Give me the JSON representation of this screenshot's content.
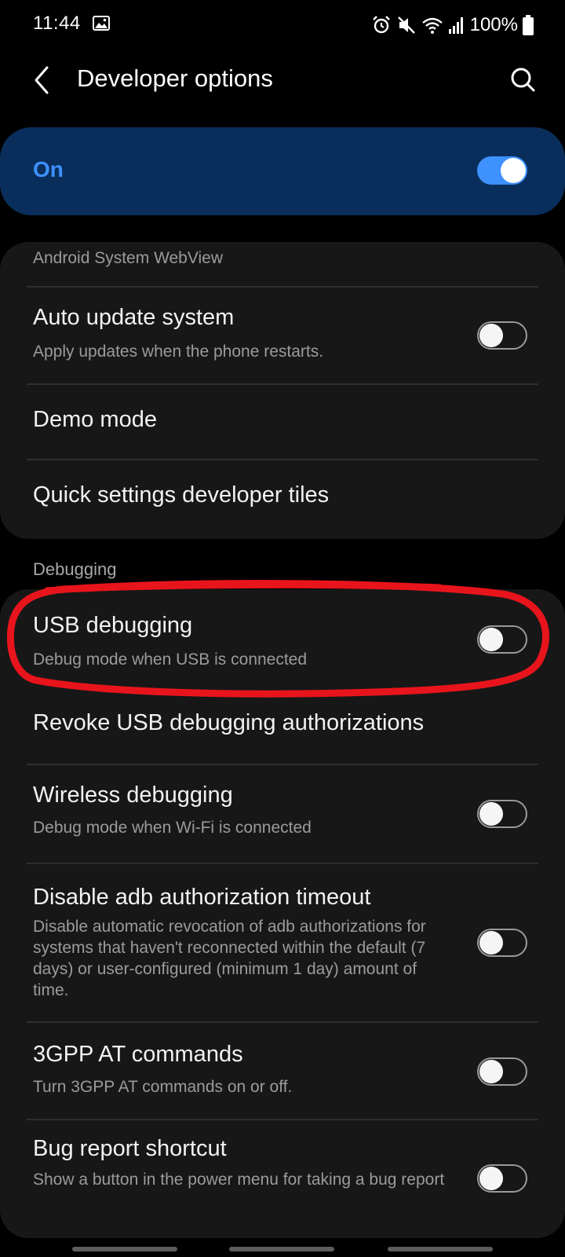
{
  "status_bar": {
    "time": "11:44",
    "battery": "100%"
  },
  "header": {
    "title": "Developer options"
  },
  "master_switch": {
    "label": "On",
    "on": true
  },
  "top_card": {
    "truncated_label": "Android System WebView",
    "items": [
      {
        "title": "Auto update system",
        "subtitle": "Apply updates when the phone restarts.",
        "toggle": false
      },
      {
        "title": "Demo mode"
      },
      {
        "title": "Quick settings developer tiles"
      }
    ]
  },
  "debugging": {
    "header": "Debugging",
    "items": [
      {
        "title": "USB debugging",
        "subtitle": "Debug mode when USB is connected",
        "toggle": false
      },
      {
        "title": "Revoke USB debugging authorizations"
      },
      {
        "title": "Wireless debugging",
        "subtitle": "Debug mode when Wi-Fi is connected",
        "toggle": false
      },
      {
        "title": "Disable adb authorization timeout",
        "subtitle": "Disable automatic revocation of adb authorizations for systems that haven't reconnected within the default (7 days) or user-configured (minimum 1 day) amount of time.",
        "toggle": false
      },
      {
        "title": "3GPP AT commands",
        "subtitle": "Turn 3GPP AT commands on or off.",
        "toggle": false
      },
      {
        "title": "Bug report shortcut",
        "subtitle": "Show a button in the power menu for taking a bug report",
        "toggle": false
      }
    ]
  },
  "colors": {
    "accent": "#3e91ff",
    "master_bg": "#0a2e5c",
    "card_bg": "#171717",
    "annotation": "#e8141c"
  },
  "icons": {
    "back": "chevron-left-icon",
    "search": "search-icon",
    "gallery": "gallery-icon",
    "alarm": "alarm-icon",
    "mute": "mute-icon",
    "wifi": "wifi-icon",
    "signal": "signal-icon",
    "battery": "battery-icon"
  }
}
